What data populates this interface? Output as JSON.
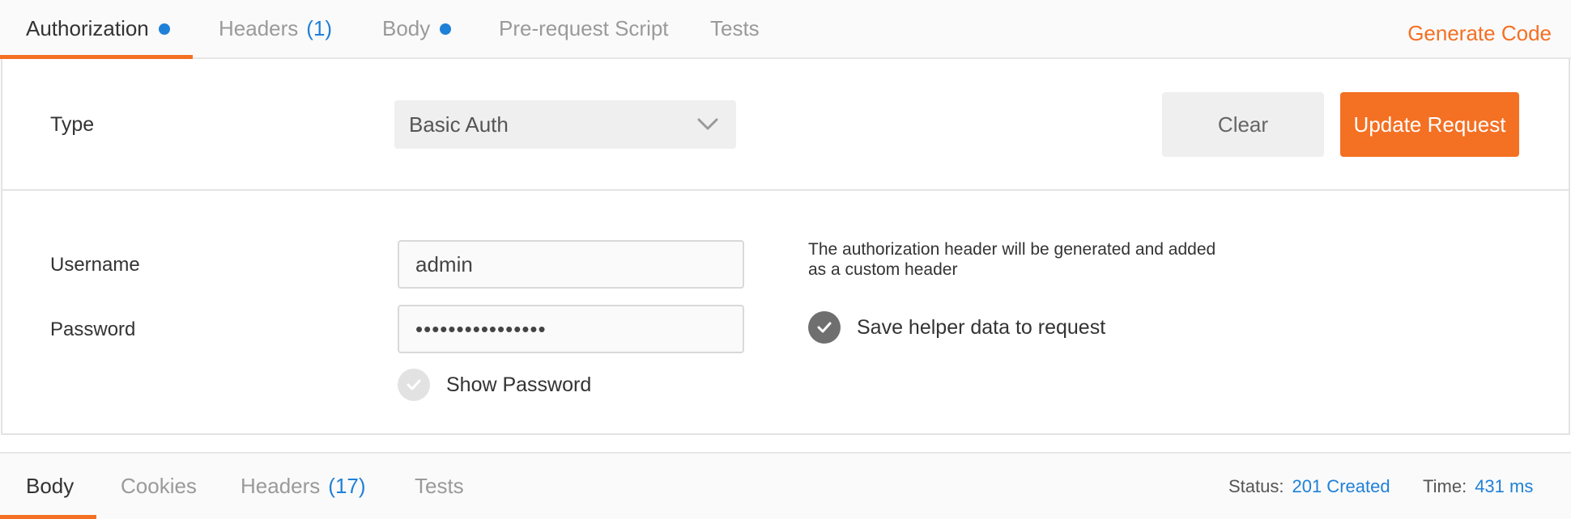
{
  "request_tabs": {
    "authorization": {
      "label": "Authorization"
    },
    "headers": {
      "label": "Headers",
      "count": "(1)"
    },
    "body": {
      "label": "Body"
    },
    "prerequest": {
      "label": "Pre-request Script"
    },
    "tests": {
      "label": "Tests"
    }
  },
  "generate_code_label": "Generate Code",
  "auth": {
    "type_label": "Type",
    "type_value": "Basic Auth",
    "clear_label": "Clear",
    "update_label": "Update Request",
    "username_label": "Username",
    "username_value": "admin",
    "password_label": "Password",
    "password_value": "••••••••••••••••",
    "show_password_label": "Show Password",
    "show_password_checked": false,
    "helper_note": "The authorization header will be generated and added as a custom header",
    "save_helper_label": "Save helper data to request",
    "save_helper_checked": true
  },
  "response_tabs": {
    "body": {
      "label": "Body"
    },
    "cookies": {
      "label": "Cookies"
    },
    "headers": {
      "label": "Headers",
      "count": "(17)"
    },
    "tests": {
      "label": "Tests"
    }
  },
  "response_meta": {
    "status_key": "Status:",
    "status_value": "201 Created",
    "time_key": "Time:",
    "time_value": "431 ms"
  },
  "colors": {
    "accent": "#f47023",
    "link_blue": "#1f80d8"
  }
}
